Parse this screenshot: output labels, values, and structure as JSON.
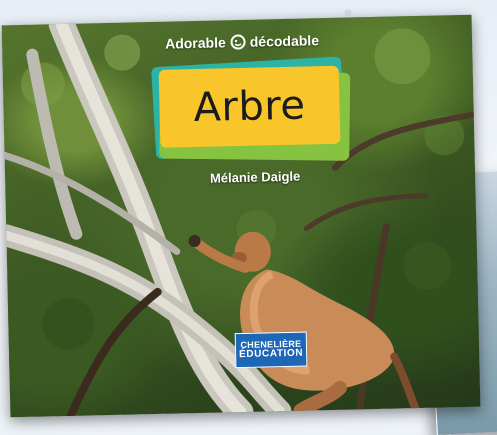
{
  "series": {
    "title_left": "Adorable",
    "title_right": "décodable",
    "logo_icon": "smiley-loop-icon"
  },
  "book": {
    "title": "Arbre",
    "author": "Mélanie Daigle"
  },
  "publisher": {
    "line1": "CHENELIÈRE",
    "line2": "ÉDUCATION"
  },
  "colors": {
    "plate_yellow": "#f8c52a",
    "plate_teal": "#2cb3a6",
    "plate_green": "#86c341",
    "publisher_blue": "#1e67b6",
    "foliage": "#3d5a22"
  }
}
